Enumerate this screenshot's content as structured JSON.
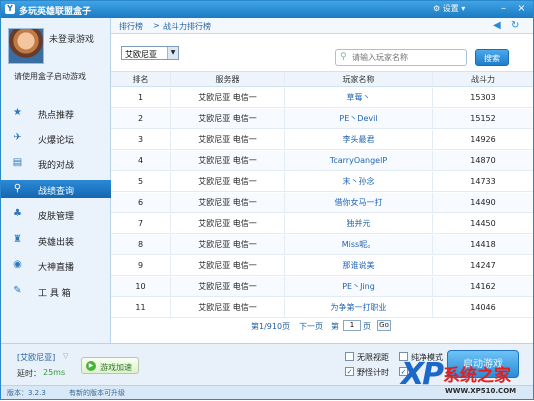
{
  "window": {
    "title": "多玩英雄联盟盒子",
    "settings_label": "设置",
    "minimize": "–",
    "close": "×"
  },
  "sidebar": {
    "login_status": "未登录游戏",
    "login_hint": "请使用盒子启动游戏",
    "items": [
      {
        "label": "热点推荐",
        "icon": "star-icon",
        "glyph": "★"
      },
      {
        "label": "火爆论坛",
        "icon": "forum-icon",
        "glyph": "✈"
      },
      {
        "label": "我的对战",
        "icon": "document-icon",
        "glyph": "▤"
      },
      {
        "label": "战绩查询",
        "icon": "search-icon",
        "glyph": "⚲"
      },
      {
        "label": "皮肤管理",
        "icon": "armor-icon",
        "glyph": "♣"
      },
      {
        "label": "英雄出装",
        "icon": "gear-icon",
        "glyph": "♜"
      },
      {
        "label": "大神直播",
        "icon": "broadcast-icon",
        "glyph": "◉"
      },
      {
        "label": "工 具 箱",
        "icon": "wrench-icon",
        "glyph": "✎"
      }
    ],
    "active_index": 3
  },
  "breadcrumb": {
    "items": [
      "排行榜",
      "战斗力排行榜"
    ],
    "separator": ">"
  },
  "filters": {
    "region": "艾欧尼亚",
    "search_placeholder": "请输入玩家名称",
    "search_button": "搜索"
  },
  "table": {
    "headers": [
      "排名",
      "服务器",
      "玩家名称",
      "战斗力"
    ],
    "rows": [
      {
        "rank": "1",
        "server": "艾欧尼亚 电信一",
        "player": "草莓丶",
        "power": "15303"
      },
      {
        "rank": "2",
        "server": "艾欧尼亚 电信一",
        "player": "PE丶Devil",
        "power": "15152"
      },
      {
        "rank": "3",
        "server": "艾欧尼亚 电信一",
        "player": "李头最君",
        "power": "14926"
      },
      {
        "rank": "4",
        "server": "艾欧尼亚 电信一",
        "player": "TcarryOangelP",
        "power": "14870"
      },
      {
        "rank": "5",
        "server": "艾欧尼亚 电信一",
        "player": "末丶孙念",
        "power": "14733"
      },
      {
        "rank": "6",
        "server": "艾欧尼亚 电信一",
        "player": "借你女马一打",
        "power": "14490"
      },
      {
        "rank": "7",
        "server": "艾欧尼亚 电信一",
        "player": "独并元",
        "power": "14450"
      },
      {
        "rank": "8",
        "server": "艾欧尼亚 电信一",
        "player": "Miss呢。",
        "power": "14418"
      },
      {
        "rank": "9",
        "server": "艾欧尼亚 电信一",
        "player": "那谁说美",
        "power": "14247"
      },
      {
        "rank": "10",
        "server": "艾欧尼亚 电信一",
        "player": "PE丶Jing",
        "power": "14162"
      },
      {
        "rank": "11",
        "server": "艾欧尼亚 电信一",
        "player": "为争第一打职业",
        "power": "14046"
      }
    ]
  },
  "pager": {
    "status": "第1/910页",
    "next": "下一页",
    "go_prefix": "第",
    "page_value": "1",
    "go_suffix": "页",
    "go_button": "Go"
  },
  "bottom": {
    "region": "[艾欧尼亚]",
    "latency_label": "延时：",
    "latency_value": "25ms",
    "accel_button": "游戏加速",
    "checkboxes": [
      {
        "label": "无限视距",
        "checked": false
      },
      {
        "label": "纯净模式",
        "checked": false
      },
      {
        "label": "野怪计时",
        "checked": true
      },
      {
        "label": "",
        "checked": true
      }
    ],
    "start_button": "启动游戏"
  },
  "status": {
    "version": "版本：3.2.3",
    "update": "有新的版本可升级"
  },
  "watermark": {
    "logo": "XP",
    "brand": "系统之家",
    "url": "WWW.XP510.COM"
  },
  "colors": {
    "accent": "#1c7ac3",
    "active_nav": "#1566b0",
    "link": "#1e63b4",
    "latency": "#2e9d2e",
    "brand": "#e02020"
  }
}
